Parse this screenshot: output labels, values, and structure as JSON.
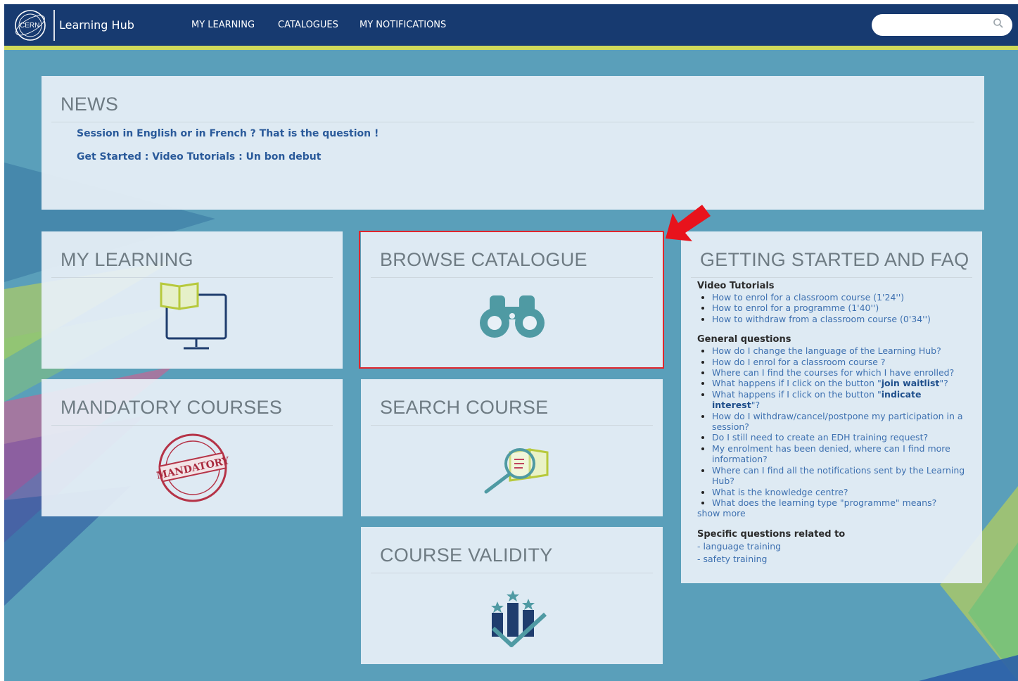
{
  "app": {
    "logo_text": "CERN",
    "title": "Learning Hub"
  },
  "nav": {
    "items": [
      "MY LEARNING",
      "CATALOGUES",
      "MY NOTIFICATIONS"
    ],
    "search_placeholder": ""
  },
  "news": {
    "title": "NEWS",
    "links": [
      "Session in English or in French ? That is the question !",
      "Get Started : Video Tutorials : Un bon debut"
    ]
  },
  "tiles": {
    "my_learning": "MY LEARNING",
    "browse_catalogue": "BROWSE CATALOGUE",
    "mandatory": "MANDATORY COURSES",
    "mandatory_stamp": "MANDATORY",
    "search_course": "SEARCH COURSE",
    "course_validity": "COURSE VALIDITY"
  },
  "faq": {
    "title": "GETTING STARTED AND FAQ",
    "video_heading": "Video Tutorials",
    "video_items": [
      "How to enrol for a classroom course (1'24'')",
      "How to enrol for a programme (1'40'')",
      "How to withdraw from a classroom course (0'34'')"
    ],
    "general_heading": "General questions",
    "general_items": [
      {
        "pre": "How do I change the language of the Learning Hub?",
        "bold": "",
        "post": ""
      },
      {
        "pre": "How do I enrol for a classroom course ?",
        "bold": "",
        "post": ""
      },
      {
        "pre": "Where can I find the courses for which I have enrolled?",
        "bold": "",
        "post": ""
      },
      {
        "pre": "What happens if I click on the button \"",
        "bold": "join waitlist",
        "post": "\"?"
      },
      {
        "pre": "What happens if I click on the button \"",
        "bold": "indicate interest",
        "post": "\"?"
      },
      {
        "pre": "How do I withdraw/cancel/postpone my participation in a session?",
        "bold": "",
        "post": ""
      },
      {
        "pre": "Do I still need to create an EDH training request?",
        "bold": "",
        "post": ""
      },
      {
        "pre": "My enrolment has been denied, where can I find more information?",
        "bold": "",
        "post": ""
      },
      {
        "pre": "Where can I find all the notifications sent by the Learning Hub?",
        "bold": "",
        "post": ""
      },
      {
        "pre": "What is the knowledge centre?",
        "bold": "",
        "post": ""
      },
      {
        "pre": "What does the learning type \"programme\" means?",
        "bold": "",
        "post": ""
      }
    ],
    "show_more": "show more",
    "specific_heading": "Specific questions related to",
    "specific_items": [
      "- language training",
      "- safety training"
    ]
  },
  "colors": {
    "nav_bg": "#173a70",
    "accent": "#cfd95a",
    "page_bg": "#5a9fba",
    "link": "#3d70b0",
    "highlight": "#e0262d"
  },
  "icons": [
    "cern-logo-icon",
    "search-icon",
    "book-computer-icon",
    "binoculars-icon",
    "mandatory-stamp-icon",
    "magnifier-book-icon",
    "validity-chart-icon",
    "red-arrow-icon"
  ]
}
